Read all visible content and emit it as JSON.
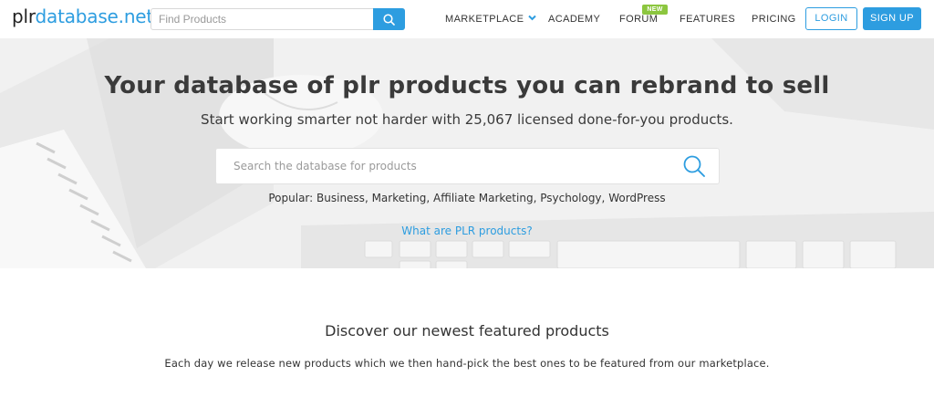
{
  "header": {
    "logo_part1": "plr",
    "logo_part2": "database.net",
    "search_placeholder": "Find Products",
    "search_icon": "search-icon",
    "nav": {
      "marketplace": "MARKETPLACE",
      "academy": "ACADEMY",
      "forum": "FORUM",
      "forum_badge": "NEW",
      "features": "FEATURES",
      "pricing": "PRICING"
    },
    "login": "LOGIN",
    "signup": "SIGN UP"
  },
  "hero": {
    "title": "Your database of plr products you can rebrand to sell",
    "subtitle": "Start working smarter not harder with 25,067 licensed done-for-you products.",
    "search_placeholder": "Search the database for products",
    "search_icon": "search-icon",
    "popular_label": "Popular:",
    "popular_items": [
      "Business",
      "Marketing",
      "Affiliate Marketing",
      "Psychology",
      "WordPress"
    ],
    "what_link": "What are PLR products?"
  },
  "featured": {
    "title": "Discover our newest featured products",
    "description": "Each day we release new products which we then hand-pick the best ones to be featured from our marketplace."
  },
  "colors": {
    "accent": "#2d9de0",
    "badge": "#8cc63f",
    "text": "#333333",
    "hero_bg": "#f3f3f3"
  }
}
